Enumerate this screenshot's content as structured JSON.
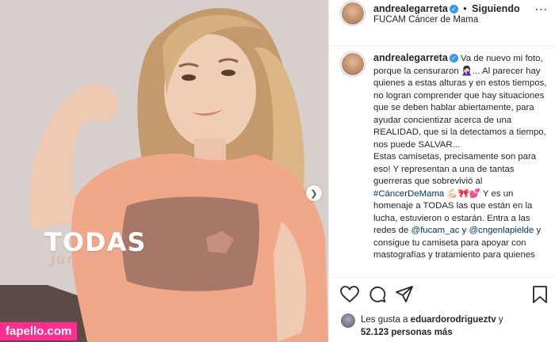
{
  "post": {
    "overlay_title": "TODAS",
    "overlay_subtitle": "juntas",
    "watermark": "fapello.com"
  },
  "header": {
    "username": "andrealegarreta",
    "separator": "•",
    "follow_status": "Siguiendo",
    "location": "FUCAM Cáncer de Mama",
    "more": "..."
  },
  "caption": {
    "username": "andrealegarreta",
    "text1": "Va de nuevo mi foto, porque la censuraron 🤦🏻‍♀️... Al parecer hay quienes a estas alturas y en estos tiempos, no logran comprender que hay situaciones que se deben hablar abiertamente, para ayudar concientizar acerca de una REALIDAD, que si la detectamos a tiempo, nos puede SALVAR...",
    "text2": "Estas camisetas, precisamente son para eso! Y representan a una de tantas guerreras que sobrevivió al",
    "hashtag": "#CáncerDeMama",
    "text3": " 💪🏻🎀💕 Y es un homenaje a TODAS las que están en la lucha, estuvieron o estarán. Entra a las redes de ",
    "mention1": "@fucam_ac",
    "text4": " y ",
    "mention2": "@cngenlapielde",
    "text5": " y consigue tu camiseta para apoyar con mastografías y tratamiento para quienes"
  },
  "likes": {
    "prefix": "Les gusta a",
    "user": "eduardorodrigueztv",
    "joiner": "y",
    "count": "52.123 personas más"
  }
}
